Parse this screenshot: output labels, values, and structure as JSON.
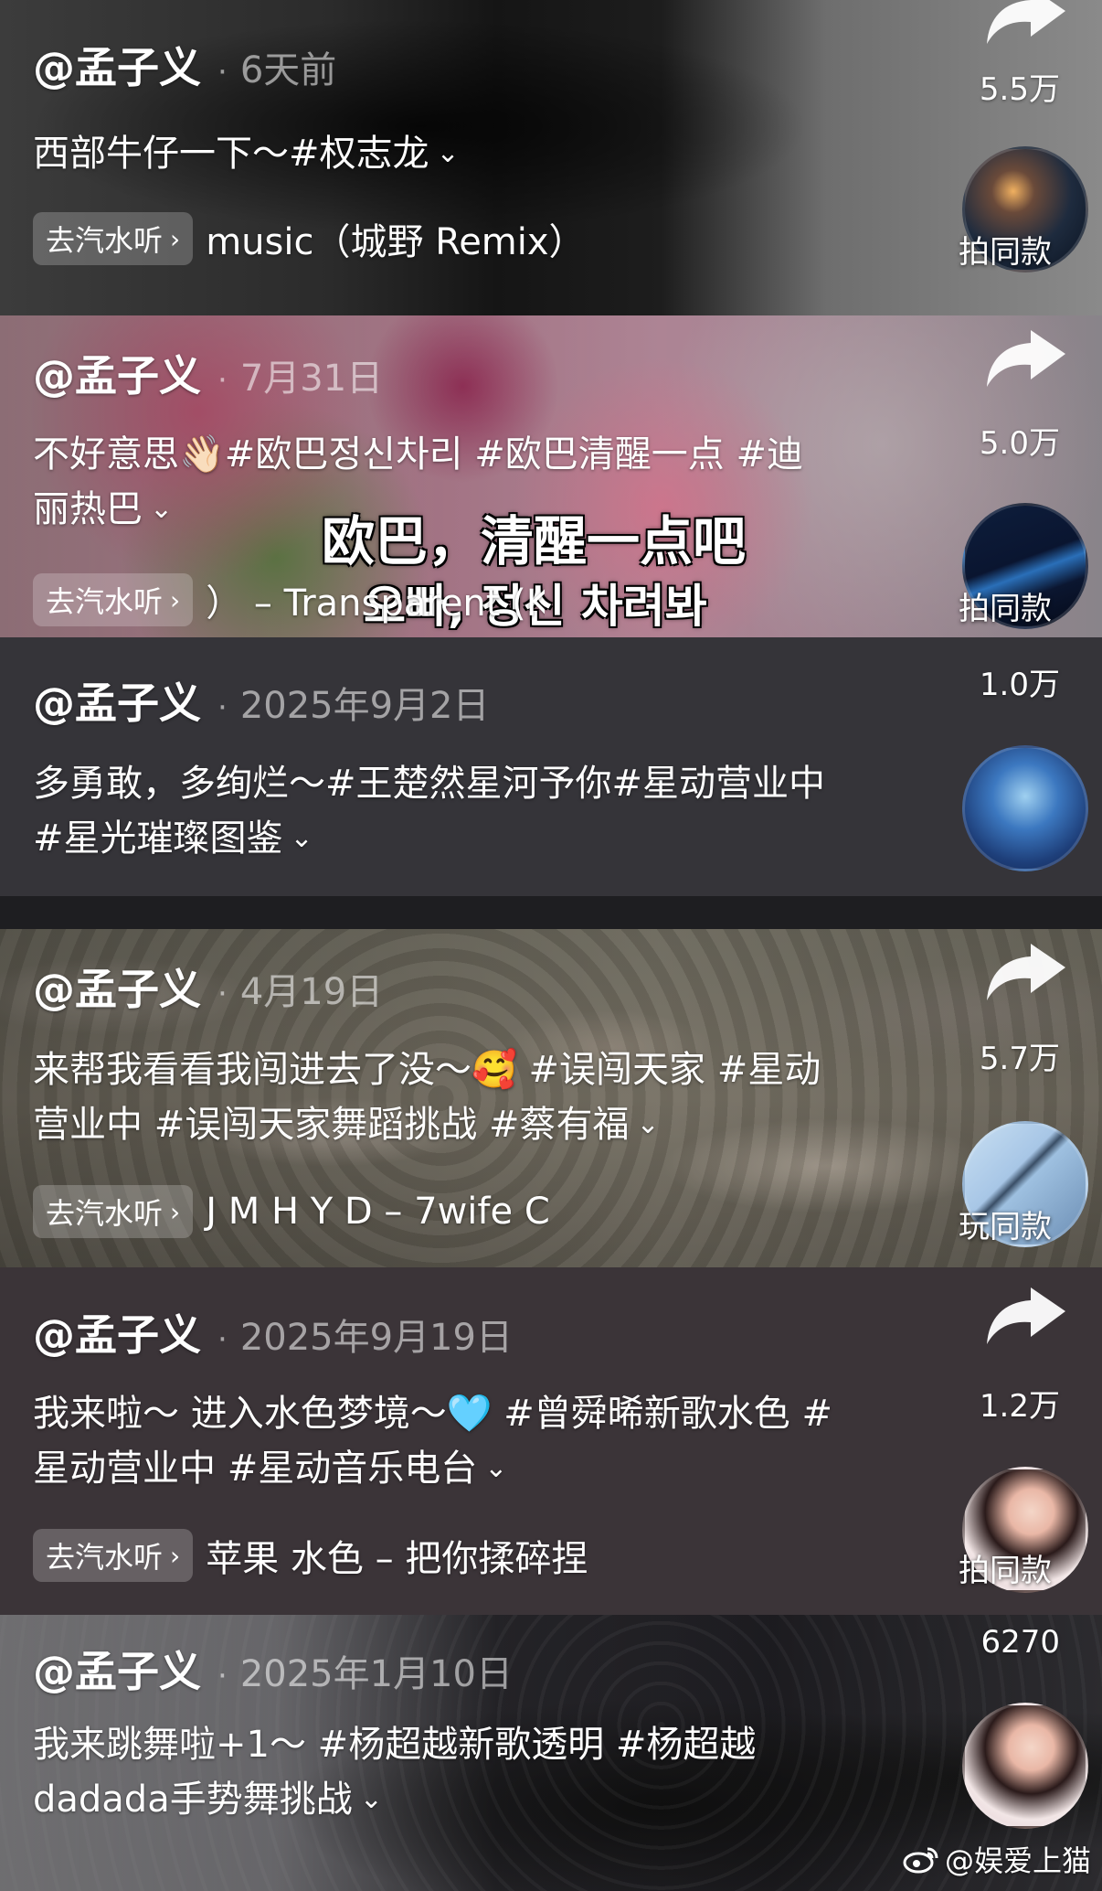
{
  "posts": [
    {
      "username": "@孟子义",
      "date": "6天前",
      "caption": "西部牛仔一下～#权志龙",
      "music_button": "去汽水听",
      "music_text": "music（城野 Remix）",
      "share_count": "5.5万",
      "thumb_label": "拍同款"
    },
    {
      "username": "@孟子义",
      "date": "7月31日",
      "caption": "不好意思👋🏻#欧巴정신차리 #欧巴清醒一点 #迪丽热巴",
      "music_button": "去汽水听",
      "music_text": "）  – Transparent  (Ko",
      "overlay_line1": "欧巴，清醒一点吧",
      "overlay_line2": "오빠, 정신 차려봐",
      "share_count": "5.0万",
      "thumb_label": "拍同款"
    },
    {
      "username": "@孟子义",
      "date": "2025年9月2日",
      "caption": "多勇敢，多绚烂～#王楚然星河予你#星动营业中#星光璀璨图鉴",
      "share_count": "1.0万"
    },
    {
      "username": "@孟子义",
      "date": "4月19日",
      "caption": "来帮我看看我闯进去了没～🥰 #误闯天家 #星动营业中 #误闯天家舞蹈挑战 #蔡有福",
      "music_button": "去汽水听",
      "music_text": "J M H Y D – 7wife  C",
      "share_count": "5.7万",
      "thumb_label": "玩同款"
    },
    {
      "username": "@孟子义",
      "date": "2025年9月19日",
      "caption": "我来啦～ 进入水色梦境～🩵 #曾舜晞新歌水色 #星动营业中 #星动音乐电台",
      "music_button": "去汽水听",
      "music_text": "苹果  水色 – 把你揉碎捏",
      "share_count": "1.2万",
      "thumb_label": "拍同款"
    },
    {
      "username": "@孟子义",
      "date": "2025年1月10日",
      "caption": "我来跳舞啦+1～ #杨超越新歌透明 #杨超越dadada手势舞挑战",
      "share_count": "6270"
    }
  ],
  "watermark": "@娱爱上猫",
  "icons": {
    "share": "share-arrow-icon",
    "chevron": "chevron-down-icon",
    "weibo": "weibo-logo-icon"
  }
}
